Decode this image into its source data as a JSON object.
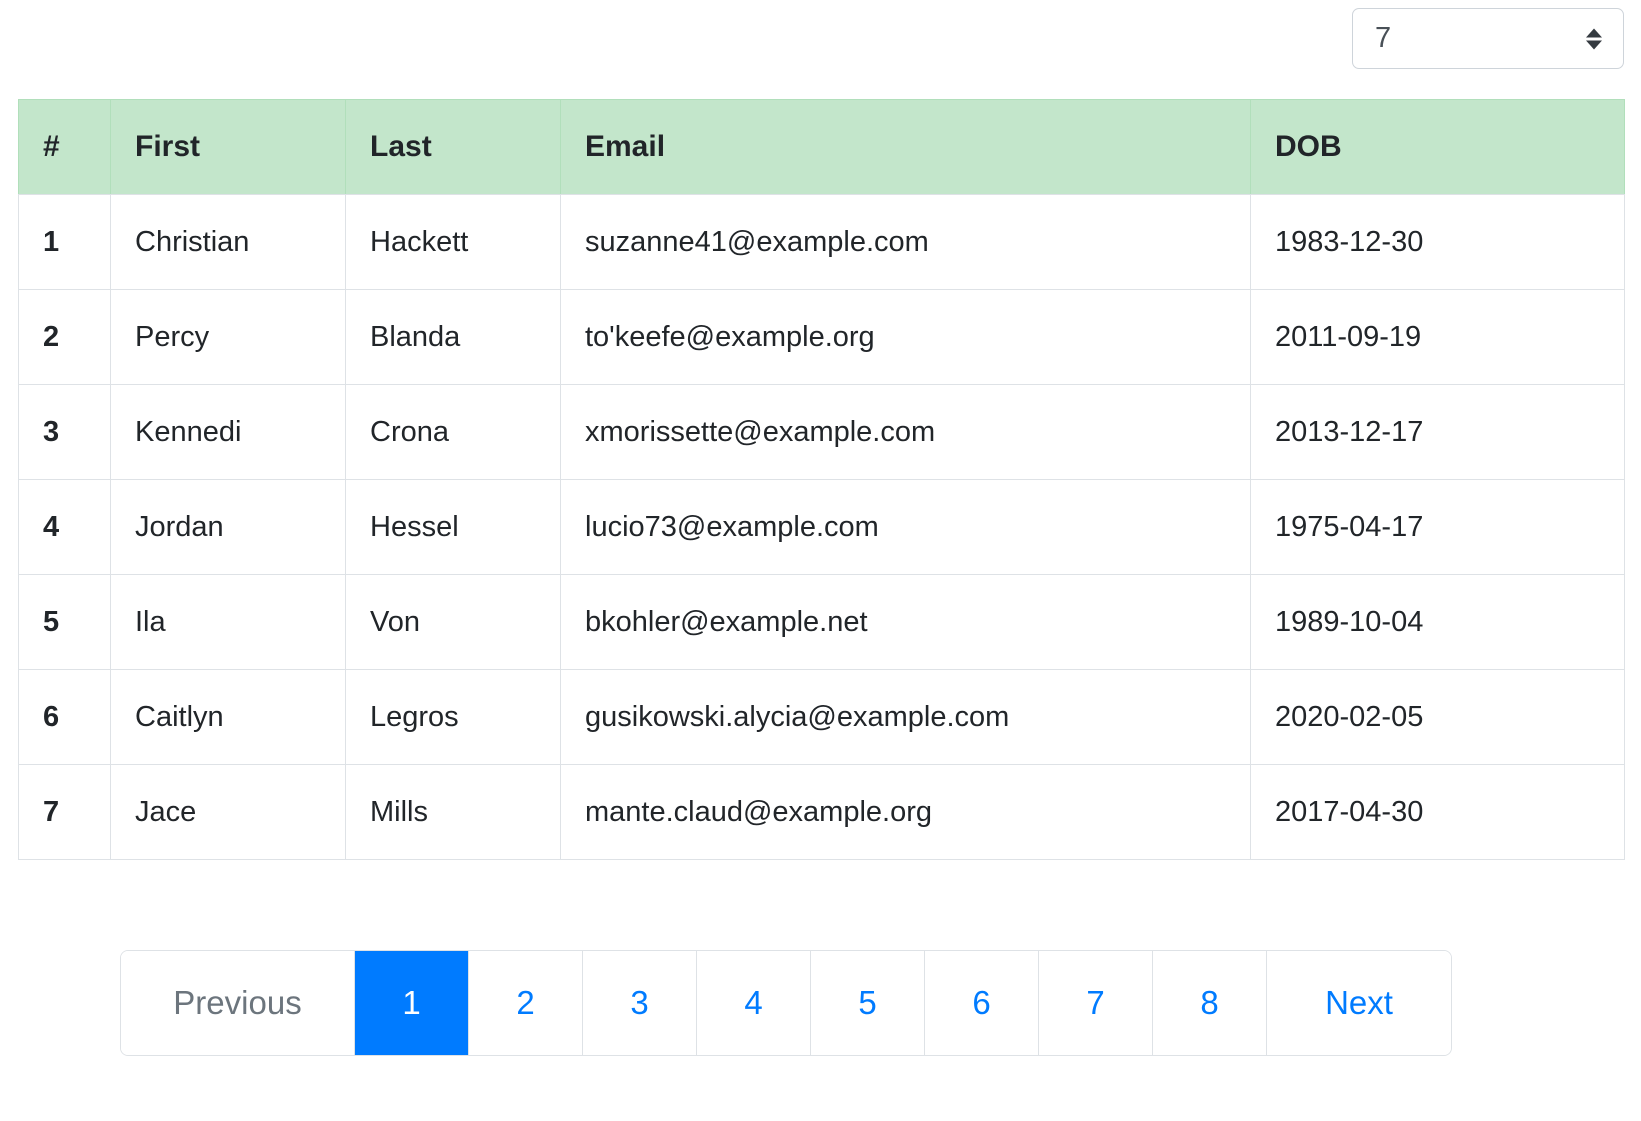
{
  "toolbar": {
    "per_page_label": "7",
    "per_page_selected": "7",
    "per_page_options": [
      "7"
    ],
    "stepper_icon": "spinner-updown-icon"
  },
  "table": {
    "columns": [
      "#",
      "First",
      "Last",
      "Email",
      "DOB"
    ],
    "header_bg": "#c3e6cb",
    "rows": [
      {
        "num": "1",
        "first": "Christian",
        "last": "Hackett",
        "email": "suzanne41@example.com",
        "dob": "1983-12-30"
      },
      {
        "num": "2",
        "first": "Percy",
        "last": "Blanda",
        "email": "to'keefe@example.org",
        "dob": "2011-09-19"
      },
      {
        "num": "3",
        "first": "Kennedi",
        "last": "Crona",
        "email": "xmorissette@example.com",
        "dob": "2013-12-17"
      },
      {
        "num": "4",
        "first": "Jordan",
        "last": "Hessel",
        "email": "lucio73@example.com",
        "dob": "1975-04-17"
      },
      {
        "num": "5",
        "first": "Ila",
        "last": "Von",
        "email": "bkohler@example.net",
        "dob": "1989-10-04"
      },
      {
        "num": "6",
        "first": "Caitlyn",
        "last": "Legros",
        "email": "gusikowski.alycia@example.com",
        "dob": "2020-02-05"
      },
      {
        "num": "7",
        "first": "Jace",
        "last": "Mills",
        "email": "mante.claud@example.org",
        "dob": "2017-04-30"
      }
    ]
  },
  "pagination": {
    "previous_label": "Previous",
    "next_label": "Next",
    "pages": [
      "1",
      "2",
      "3",
      "4",
      "5",
      "6",
      "7",
      "8"
    ],
    "active_page": "1",
    "active_color": "#007bff",
    "link_color": "#007bff",
    "disabled_color": "#6c757d"
  }
}
